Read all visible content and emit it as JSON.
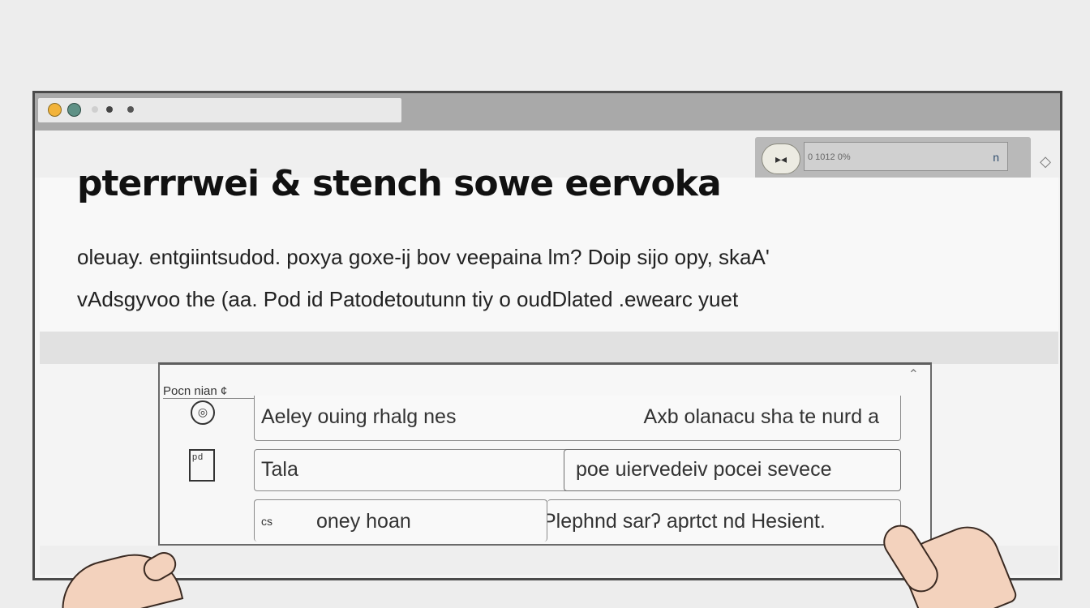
{
  "window": {
    "address_placeholder": "0 1012 0%",
    "address_pill_label": "▸◂",
    "address_suffix": "n"
  },
  "hero": {
    "headline": "pterrrwei & stench sowe eervoka",
    "para_line1": "oleuay. entgiintsudod. poxya goxe-ĳ bov veepaina lm? Doip sijo opy, skaA'",
    "para_line2": "vAdsgyvoo the (aa. Pod id Patodetoutunn tiy o oudDlated .ewearc yuet"
  },
  "card": {
    "label": "Pocn nian ¢",
    "rows": [
      {
        "left": "Aeley ouing rhalg nes",
        "right": "Axb olanacu sha te nurd a"
      },
      {
        "left": "Tala",
        "right": "poe uiervedeiv pocei sevece"
      },
      {
        "left_prefix": "cs",
        "left": "oney hoan",
        "right": "Plephnd sarʔ aprtct nd Hesient."
      }
    ]
  },
  "colors": {
    "dot_yellow": "#f2b33a",
    "dot_teal": "#5f9186",
    "titlebar": "#a9a9a9"
  },
  "icons": [
    "gear-icon",
    "document-icon",
    "diamond-icon",
    "chevron-up-icon"
  ]
}
